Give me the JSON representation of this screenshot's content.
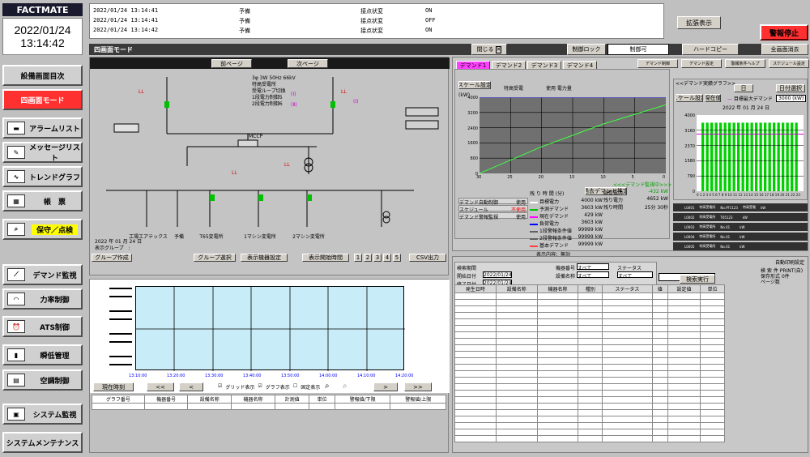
{
  "brand": "FACTMATE",
  "date": "2022/01/24",
  "time": "13:14:42",
  "alarms": [
    {
      "ts": "2022/01/24 13:14:41",
      "type": "予備",
      "event": "接点状変",
      "state": "ON"
    },
    {
      "ts": "2022/01/24 13:14:41",
      "type": "予備",
      "event": "接点状変",
      "state": "OFF"
    },
    {
      "ts": "2022/01/24 13:14:42",
      "type": "予備",
      "event": "接点状変",
      "state": "ON"
    }
  ],
  "expand_btn": "拡張表示",
  "alarm_stop_btn": "警報停止",
  "screen_title": "四画面モード",
  "close_btn": "閉じる",
  "control_lock_btn": "制御ロック",
  "control_ok": "制御可",
  "hardcopy_btn": "ハードコピー",
  "clear_all_btn": "全画面消去",
  "sidebar": [
    {
      "label": "設備画面目次",
      "icon": "",
      "active": false
    },
    {
      "label": "四画面モード",
      "icon": "",
      "active": true
    },
    {
      "label": "アラームリスト",
      "icon": "▬",
      "active": false
    },
    {
      "label": "メッセージリスト",
      "icon": "✎",
      "active": false
    },
    {
      "label": "トレンドグラフ",
      "icon": "∿",
      "active": false
    },
    {
      "label": "帳　票",
      "icon": "▦",
      "active": false
    },
    {
      "label": "保守／点検",
      "icon": "⌕",
      "active": false,
      "yellow": true
    },
    {
      "label": "デマンド監視",
      "icon": "⟋",
      "active": false
    },
    {
      "label": "力率制御",
      "icon": "◠",
      "active": false
    },
    {
      "label": "ATS制御",
      "icon": "⏰",
      "active": false
    },
    {
      "label": "瞬低管理",
      "icon": "▮",
      "active": false
    },
    {
      "label": "空調制御",
      "icon": "▤",
      "active": false
    },
    {
      "label": "システム監視",
      "icon": "▣",
      "active": false
    },
    {
      "label": "システムメンテナンス",
      "icon": "",
      "active": false
    }
  ],
  "q1": {
    "prev_btn": "前ページ",
    "next_btn": "次ページ",
    "header_line1": "3φ  3W 50Hz 66kV",
    "header_line2": "特高受電所",
    "header_line3": "受電ループ切換",
    "header_line4": "1段電力制御5",
    "header_line5": "2段電力制御6",
    "mcp": "MCCP",
    "loads": [
      "工場エアテックス",
      "予備",
      "T65変電所",
      "1マシン変電所",
      "2マシン変電所"
    ],
    "date_label": "2022 年 01 月 24 日",
    "group_label": "表示グループ　:",
    "group_create": "グループ作成",
    "group_select": "グループ選択",
    "display_settings": "表示機器設定",
    "display_time": "表示開始時間",
    "pages": [
      "1",
      "2",
      "3",
      "4",
      "5"
    ],
    "csv": "CSV出力",
    "time_ticks": [
      "13:10:00",
      "13:20:00",
      "13:30:00",
      "13:40:00",
      "13:50:00",
      "14:00:00",
      "14:10:00",
      "14:20:00"
    ],
    "current_time_btn": "現在時刻",
    "grid_show": "グリッド表示",
    "graph_show": "グラフ表示",
    "scale_fixed": "固定表示",
    "cols": [
      "グラフ番号",
      "機器番号",
      "設備名称",
      "機器名称",
      "計測値",
      "単位",
      "警報値/下限",
      "警報値/上限"
    ]
  },
  "q2": {
    "tabs": [
      "デマンド1",
      "デマンド2",
      "デマンド3",
      "デマンド4"
    ],
    "right_tabs": [
      "デマンド制御",
      "デマンド設定",
      "警報条件ヘルプ",
      "スケジュール設定"
    ],
    "scale_btn": "スケール設定",
    "line_title": "特高受電",
    "line_unit": "使用 電力量",
    "y_unit": "(kW)",
    "y_ticks": [
      "4000",
      "3200",
      "2400",
      "1600",
      "800",
      "0"
    ],
    "x_ticks": [
      "30",
      "25",
      "20",
      "15",
      "10",
      "5",
      "0"
    ],
    "remain_label": "残 り 時 間 (分)",
    "demand_btn": "過去デマンド推定",
    "status_left": [
      [
        "デマンド自動制御",
        "使用"
      ],
      [
        "スケジュール",
        "不使用"
      ],
      [
        "デマンド警報監視",
        "使用"
      ]
    ],
    "legend": [
      {
        "name": "目標電力",
        "val": "4000 kW",
        "color": "#ffffff"
      },
      {
        "name": "予測デマンド",
        "val": "3603 kW",
        "color": "#00c000"
      },
      {
        "name": "現在デマンド",
        "val": "429 kW",
        "color": "#ff00ff"
      },
      {
        "name": "負荷電力",
        "val": "3603 kW",
        "color": "#0000ff"
      },
      {
        "name": "1段警報条件値",
        "val": "99999 kW",
        "color": "#606060"
      },
      {
        "name": "2段警報条件値",
        "val": "99999 kW",
        "color": "#606060"
      },
      {
        "name": "基本デマンド",
        "val": "99999 kW",
        "color": "#ff4040"
      }
    ],
    "right_vals": [
      [
        "調整電力",
        "-432 kW"
      ],
      [
        "残り電力",
        "4652 kW"
      ],
      [
        "残り時間",
        "25分 30秒"
      ]
    ],
    "display_content": "表示内容：無効",
    "demand_notice": "<<<デマンド監視中>>>",
    "bar_title": "<<デマンド実績グラフ>>",
    "bar_day": "日",
    "bar_date_btn": "日付選択",
    "bar_scale": "スケール設定",
    "bar_period": "現在値",
    "bar_legend1": "目標最大デマンド",
    "bar_target": "3000 (kW)",
    "bar_date": "2022 年 01 月 24 日",
    "bar_y_ticks": [
      "4000",
      "3160",
      "2370",
      "1580",
      "790",
      "0"
    ],
    "bar_x_ticks": [
      "0",
      "1",
      "2",
      "3",
      "4",
      "5",
      "6",
      "7",
      "8",
      "9",
      "10",
      "11",
      "12",
      "13",
      "14",
      "15",
      "16",
      "17",
      "18",
      "19",
      "20",
      "21",
      "22",
      "23"
    ],
    "bar_unit": "(分)",
    "list": [
      {
        "id": "L0001",
        "name": "特高受電所",
        "dev": "No.PF1123",
        "kind": "特高受電",
        "unit": "kW"
      },
      {
        "id": "L0002",
        "name": "特高受電所",
        "dev": "T65123",
        "kind": "",
        "unit": "kW"
      },
      {
        "id": "L0003",
        "name": "特高受電所",
        "dev": "No.01",
        "kind": "",
        "unit": "kW"
      },
      {
        "id": "L0004",
        "name": "特高受電所",
        "dev": "No.01",
        "kind": "",
        "unit": "kW"
      },
      {
        "id": "L0005",
        "name": "特高受電所",
        "dev": "No.01",
        "kind": "",
        "unit": "kW"
      }
    ]
  },
  "q3": {
    "auto_label": "自動印刷設定",
    "search_btn": "検索実行",
    "labels": [
      "検索期間",
      "開始日付",
      "終了日付",
      "機器番号",
      "設備名称",
      "機器名称",
      "ステータス",
      "警報値"
    ],
    "start_date": "2022/01/24",
    "end_date": "2022/01/24",
    "all": "すべて",
    "cols": [
      "発生日時",
      "設備名称",
      "機器名称",
      "種別",
      "ステータス",
      "値",
      "設定値",
      "単位"
    ],
    "right_info": [
      "検 索 件",
      "保存形式",
      "ページ数"
    ],
    "right_vals": [
      "PRINT(自)",
      "0件",
      ""
    ]
  },
  "chart_data": [
    {
      "type": "line",
      "title": "特高受電",
      "ylabel": "(kW)",
      "ylim": [
        0,
        4000
      ],
      "x": [
        30,
        25,
        20,
        15,
        10,
        5,
        0
      ],
      "series": [
        {
          "name": "予測デマンド",
          "values": [
            0,
            700,
            1400,
            2000,
            2600,
            3100,
            3600
          ]
        },
        {
          "name": "目標電力",
          "values": [
            4000,
            4000,
            4000,
            4000,
            4000,
            4000,
            4000
          ]
        }
      ]
    },
    {
      "type": "bar",
      "title": "<<デマンド実績グラフ>>",
      "ylabel": "(kW)",
      "ylim": [
        0,
        4000
      ],
      "categories": [
        "1",
        "2",
        "3",
        "4",
        "5",
        "6",
        "7",
        "8",
        "9",
        "10",
        "11",
        "12",
        "13",
        "14",
        "15",
        "16",
        "17",
        "18",
        "19",
        "20",
        "21",
        "22"
      ],
      "values": [
        3600,
        3600,
        3600,
        3600,
        3600,
        3600,
        3600,
        3600,
        3600,
        3600,
        3600,
        3600,
        3600,
        3600,
        3600,
        3600,
        3600,
        3600,
        3600,
        3600,
        3600,
        3600
      ]
    }
  ]
}
